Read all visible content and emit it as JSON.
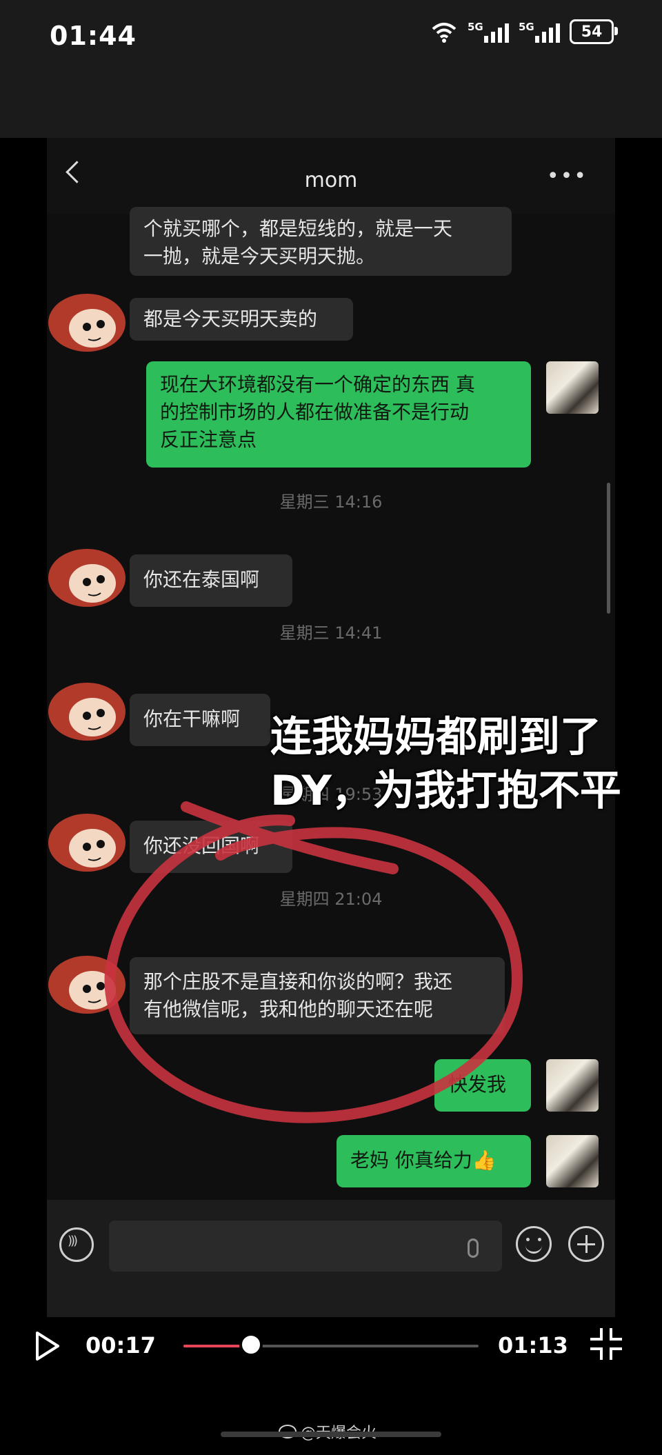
{
  "status_bar": {
    "time": "01:44",
    "signal_label_1": "5G",
    "signal_label_2": "5G",
    "battery": "54"
  },
  "chat": {
    "title": "mom",
    "messages": [
      {
        "from": "mom",
        "text_line1": "个就买哪个，都是短线的，就是一天",
        "text_line2": "一抛，就是今天买明天抛。"
      },
      {
        "from": "mom",
        "text": "都是今天买明天卖的"
      },
      {
        "from": "me",
        "text_line1": "现在大环境都没有一个确定的东西 真",
        "text_line2": "的控制市场的人都在做准备不是行动",
        "text_line3": "反正注意点"
      },
      {
        "from": "mom",
        "text": "你还在泰国啊"
      },
      {
        "from": "mom",
        "text": "你在干嘛啊"
      },
      {
        "from": "mom",
        "text": "你还没回国啊"
      },
      {
        "from": "mom",
        "text_line1": "那个庄股不是直接和你谈的啊？我还",
        "text_line2": "有他微信呢，我和他的聊天还在呢"
      },
      {
        "from": "me",
        "text": "快发我"
      },
      {
        "from": "me",
        "text": "老妈 你真给力👍"
      }
    ],
    "timestamps": [
      "星期三 14:16",
      "星期三 14:41",
      "星期四 19:53",
      "星期四 21:04"
    ]
  },
  "caption": {
    "line1": "连我妈妈都刷到了",
    "line2": "DY，为我打抱不平"
  },
  "player": {
    "current_time": "00:17",
    "total_time": "01:13",
    "progress": 0.23
  },
  "watermark": "@天爆会火",
  "colors": {
    "outgoing_bubble": "#2dbd5a",
    "incoming_bubble": "#2c2c2c",
    "progress_accent": "#e8455a",
    "annotation_red": "#c8333f"
  },
  "icons": [
    "wifi-icon",
    "signal-icon",
    "battery-icon",
    "back-icon",
    "more-icon",
    "voice-icon",
    "mic-icon",
    "emoji-icon",
    "plus-icon",
    "play-icon",
    "collapse-icon",
    "weibo-icon"
  ]
}
